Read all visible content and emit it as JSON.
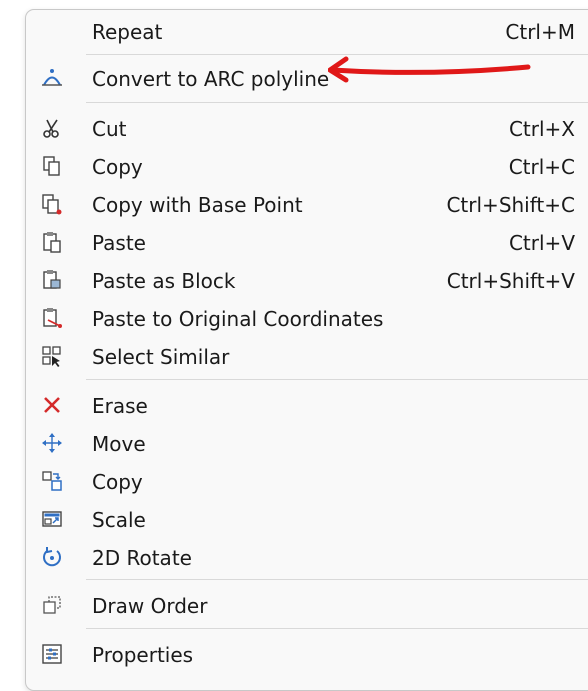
{
  "menu": {
    "items": {
      "repeat": {
        "label": "Repeat",
        "shortcut": "Ctrl+M"
      },
      "convert_arc": {
        "label": "Convert to ARC polyline"
      },
      "cut": {
        "label": "Cut",
        "shortcut": "Ctrl+X"
      },
      "copy": {
        "label": "Copy",
        "shortcut": "Ctrl+C"
      },
      "copy_base": {
        "label": "Copy with Base Point",
        "shortcut": "Ctrl+Shift+C"
      },
      "paste": {
        "label": "Paste",
        "shortcut": "Ctrl+V"
      },
      "paste_block": {
        "label": "Paste as Block",
        "shortcut": "Ctrl+Shift+V"
      },
      "paste_orig": {
        "label": "Paste to Original Coordinates"
      },
      "select_similar": {
        "label": "Select Similar"
      },
      "erase": {
        "label": "Erase"
      },
      "move": {
        "label": "Move"
      },
      "copy2": {
        "label": "Copy"
      },
      "scale": {
        "label": "Scale"
      },
      "rotate": {
        "label": "2D Rotate"
      },
      "draw_order": {
        "label": "Draw Order"
      },
      "properties": {
        "label": "Properties"
      }
    }
  },
  "colors": {
    "accent_blue": "#2f6fc4",
    "erase_red": "#d42a2a",
    "annotation_red": "#e01818"
  }
}
